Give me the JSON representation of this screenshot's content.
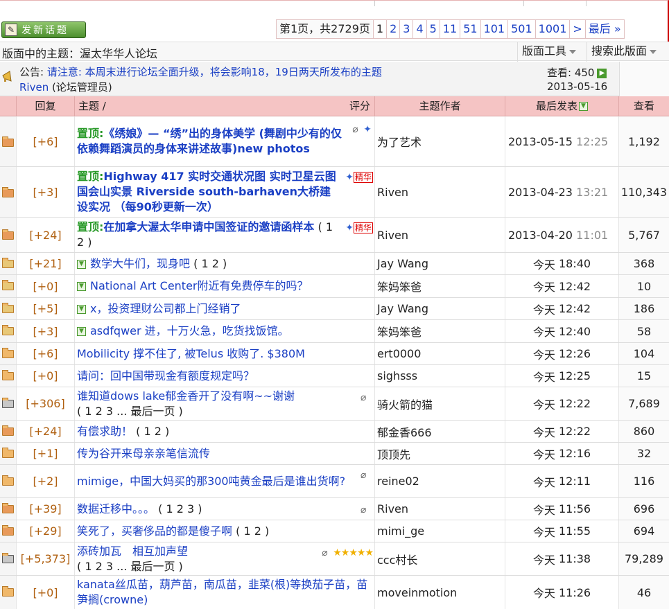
{
  "toolbar": {
    "new_topic_label": "发新话题",
    "page_info": "第1页，共2729页",
    "pages": [
      "1",
      "2",
      "3",
      "4",
      "5",
      "11",
      "51",
      "101",
      "501",
      "1001",
      ">",
      "最后 »"
    ]
  },
  "forum": {
    "title": "版面中的主题：渥太华华人论坛",
    "tools_label": "版面工具",
    "search_label": "搜索此版面"
  },
  "announcement": {
    "label": "公告:",
    "text": "请注意: 本周末进行论坛全面升级，将会影响18，19日两天所发布的主题",
    "author": "Riven",
    "author_role": "(论坛管理员)",
    "views": "查看: 450",
    "date": "2013-05-16"
  },
  "table_header": {
    "reply": "回复",
    "topic": "主题 /",
    "rating": "评分",
    "author": "主题作者",
    "last_post": "最后发表",
    "views": "查看"
  },
  "rows": [
    {
      "reply": "[+6]",
      "prefix": "置顶:",
      "title": "《绣娘》— “绣”出的身体美学 (舞剧中少有的仅依赖舞蹈演员的身体来讲述故事)new photos",
      "pages": "",
      "author": "为了艺术",
      "date": "2013-05-15",
      "time": "12:25",
      "views": "1,192"
    },
    {
      "reply": "[+3]",
      "prefix": "置顶:",
      "title": "Highway 417 实时交通状况图 实时卫星云图 国会山实景 Riverside south-barhaven大桥建设实况 （每90秒更新一次）",
      "pages": "",
      "author": "Riven",
      "date": "2013-04-23",
      "time": "13:21",
      "views": "110,343",
      "tag": "精华"
    },
    {
      "reply": "[+24]",
      "prefix": "置顶:",
      "title": "在加拿大渥太华申请中国签证的邀请函样本",
      "pages": "( 1 2 )",
      "author": "Riven",
      "date": "2013-04-20",
      "time": "11:01",
      "views": "5,767",
      "tag": "精华"
    },
    {
      "reply": "[+21]",
      "title": "数学大牛们，现身吧",
      "pages": "( 1 2 )",
      "author": "Jay Wang",
      "date": "今天",
      "time": "18:40",
      "views": "368"
    },
    {
      "reply": "[+0]",
      "title": "National Art Center附近有免费停车的吗？",
      "pages": "",
      "author": "笨妈笨爸",
      "date": "今天",
      "time": "12:42",
      "views": "10"
    },
    {
      "reply": "[+5]",
      "title": "x，投资理财公司都上门经销了",
      "pages": "",
      "author": "Jay Wang",
      "date": "今天",
      "time": "12:42",
      "views": "186"
    },
    {
      "reply": "[+3]",
      "title": "asdfqwer 进，十万火急，吃货找饭馆。",
      "pages": "",
      "author": "笨妈笨爸",
      "date": "今天",
      "time": "12:40",
      "views": "58"
    },
    {
      "reply": "[+6]",
      "title": "Mobilicity 撑不住了, 被Telus 收购了. $380M",
      "pages": "",
      "author": "ert0000",
      "date": "今天",
      "time": "12:26",
      "views": "104"
    },
    {
      "reply": "[+0]",
      "title": "请问：回中国带现金有额度规定吗？",
      "pages": "",
      "author": "sighsss",
      "date": "今天",
      "time": "12:25",
      "views": "15"
    },
    {
      "reply": "[+306]",
      "title": "谁知道dows lake郁金香开了没有啊~~谢谢",
      "pages": "( 1 2 3 ... 最后一页 )",
      "author": "骑火箭的猫",
      "date": "今天",
      "time": "12:22",
      "views": "7,689"
    },
    {
      "reply": "[+24]",
      "title": "有偿求助！",
      "pages": "( 1 2 )",
      "author": "郁金香666",
      "date": "今天",
      "time": "12:22",
      "views": "860"
    },
    {
      "reply": "[+1]",
      "title": "传为谷开来母亲亲笔信流传",
      "pages": "",
      "author": "顶顶先",
      "date": "今天",
      "time": "12:16",
      "views": "32"
    },
    {
      "reply": "[+2]",
      "title": "mimige，中国大妈买的那300吨黄金最后是谁出货啊?",
      "pages": "",
      "author": "reine02",
      "date": "今天",
      "time": "12:11",
      "views": "116"
    },
    {
      "reply": "[+39]",
      "title": "数据迁移中。。。",
      "pages": "( 1 2 3 )",
      "author": "Riven",
      "date": "今天",
      "time": "11:56",
      "views": "696"
    },
    {
      "reply": "[+29]",
      "title": "笑死了，买奢侈品的都是傻子啊",
      "pages": "( 1 2 )",
      "author": "mimi_ge",
      "date": "今天",
      "time": "11:55",
      "views": "694"
    },
    {
      "reply": "[+5,373]",
      "title": "添砖加瓦　相互加声望",
      "pages": "( 1 2 3 ... 最后一页 )",
      "author": "ccc村长",
      "date": "今天",
      "time": "11:38",
      "views": "79,289"
    },
    {
      "reply": "[+0]",
      "title": "kanata丝瓜苗，葫芦苗，南瓜苗，韭菜(根)等换茄子苗，苗笋搁(crowne)",
      "pages": "",
      "author": "moveinmotion",
      "date": "今天",
      "time": "11:26",
      "views": "46"
    }
  ]
}
